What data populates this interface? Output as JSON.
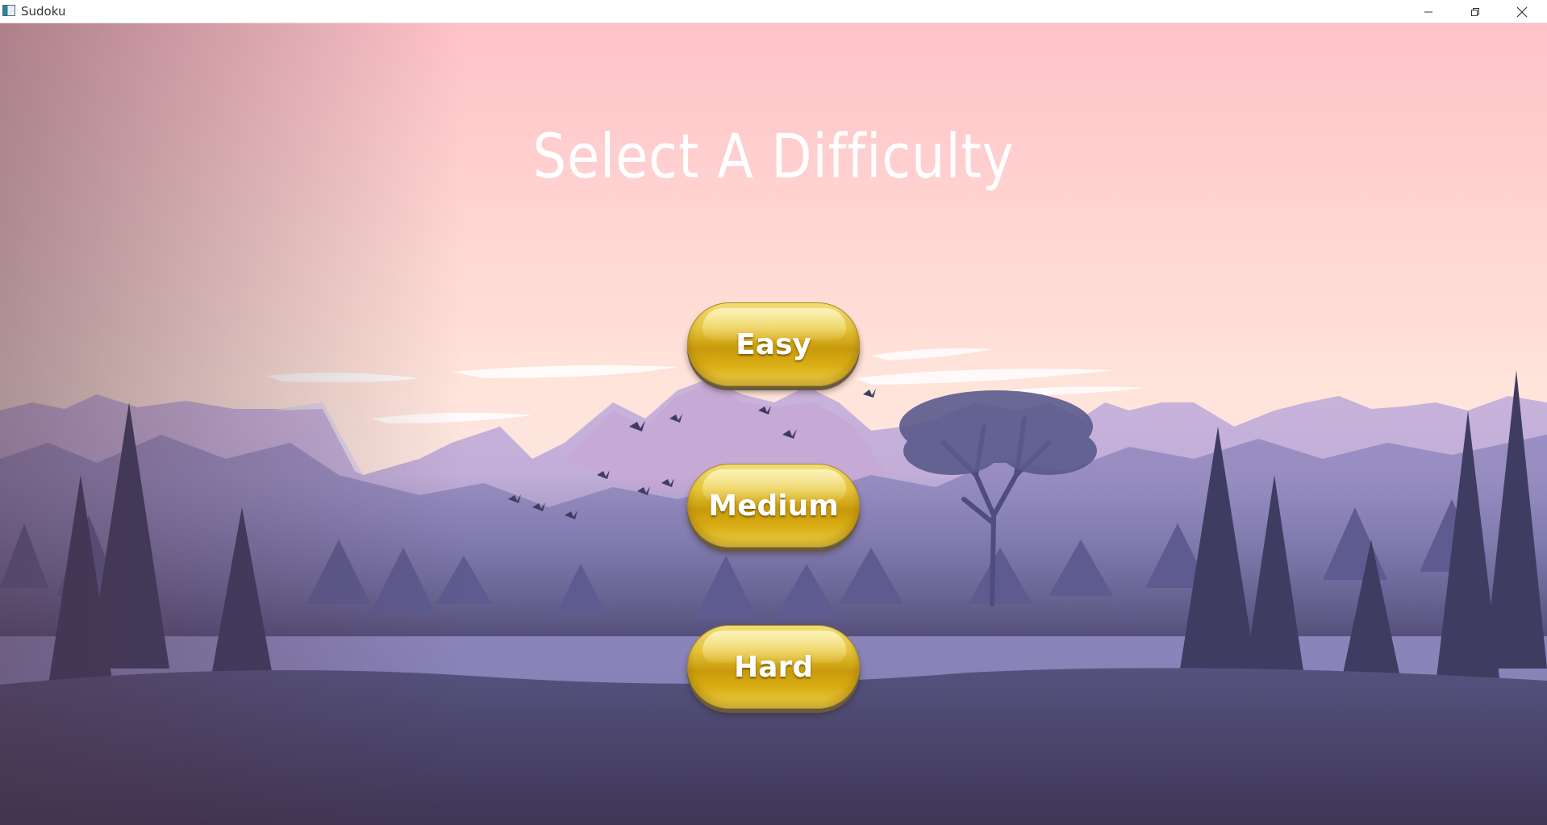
{
  "window": {
    "title": "Sudoku",
    "controls": [
      "minimize-icon",
      "restore-icon",
      "close-icon"
    ]
  },
  "screen": {
    "heading": "Select A Difficulty",
    "buttons": {
      "easy": "Easy",
      "medium": "Medium",
      "hard": "Hard"
    }
  },
  "colors": {
    "sky_top": "#ffc2c8",
    "sky_horizon": "#ffe8dc",
    "mountains": "#a897c8",
    "forest_dark": "#3d3a5c",
    "button_gold": "#d9ad14",
    "heading_text": "#ffffff"
  }
}
